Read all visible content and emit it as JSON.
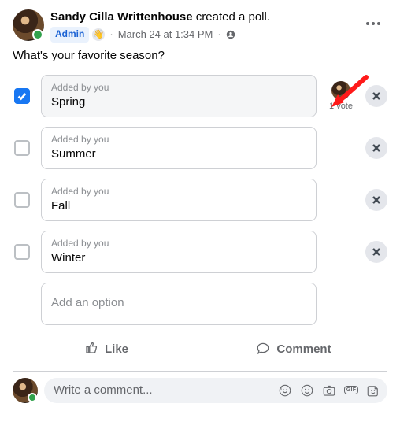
{
  "header": {
    "author_name": "Sandy Cilla Writtenhouse",
    "action_text": " created a poll.",
    "admin_label": "Admin",
    "wave_emoji": "👋",
    "timestamp": "March 24 at 1:34 PM",
    "privacy_icon_name": "group-icon"
  },
  "poll": {
    "question": "What's your favorite season?",
    "options": [
      {
        "meta": "Added by you",
        "label": "Spring",
        "checked": true,
        "votes_text": "1 vote",
        "show_voter_avatar": true
      },
      {
        "meta": "Added by you",
        "label": "Summer",
        "checked": false,
        "votes_text": "",
        "show_voter_avatar": false
      },
      {
        "meta": "Added by you",
        "label": "Fall",
        "checked": false,
        "votes_text": "",
        "show_voter_avatar": false
      },
      {
        "meta": "Added by you",
        "label": "Winter",
        "checked": false,
        "votes_text": "",
        "show_voter_avatar": false
      }
    ],
    "add_option_placeholder": "Add an option"
  },
  "actions": {
    "like_label": "Like",
    "comment_label": "Comment"
  },
  "comment": {
    "placeholder": "Write a comment...",
    "gif_label": "GIF"
  }
}
